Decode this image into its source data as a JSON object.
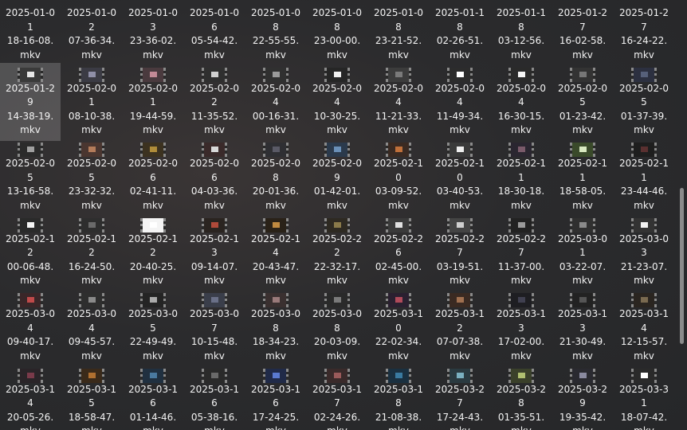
{
  "files": [
    {
      "name": "2025-01-01 18-16-08.mkv",
      "line1": "2025-01-0",
      "line2": "1",
      "line3": "18-16-08.",
      "ext": "mkv",
      "thumb_tone": "#2e2e2e"
    },
    {
      "name": "2025-01-02 07-36-34.mkv",
      "line1": "2025-01-0",
      "line2": "2",
      "line3": "07-36-34.",
      "ext": "mkv",
      "thumb_tone": "#2e2e2e"
    },
    {
      "name": "2025-01-03 23-36-02.mkv",
      "line1": "2025-01-0",
      "line2": "3",
      "line3": "23-36-02.",
      "ext": "mkv",
      "thumb_tone": "#2e2e2e"
    },
    {
      "name": "2025-01-06 05-54-42.mkv",
      "line1": "2025-01-0",
      "line2": "6",
      "line3": "05-54-42.",
      "ext": "mkv",
      "thumb_tone": "#2e2e2e"
    },
    {
      "name": "2025-01-08 22-55-55.mkv",
      "line1": "2025-01-0",
      "line2": "8",
      "line3": "22-55-55.",
      "ext": "mkv",
      "thumb_tone": "#2e2e2e"
    },
    {
      "name": "2025-01-08 23-00-00.mkv",
      "line1": "2025-01-0",
      "line2": "8",
      "line3": "23-00-00.",
      "ext": "mkv",
      "thumb_tone": "#2e2e2e"
    },
    {
      "name": "2025-01-08 23-21-52.mkv",
      "line1": "2025-01-0",
      "line2": "8",
      "line3": "23-21-52.",
      "ext": "mkv",
      "thumb_tone": "#2e2e2e"
    },
    {
      "name": "2025-01-18 02-26-51.mkv",
      "line1": "2025-01-1",
      "line2": "8",
      "line3": "02-26-51.",
      "ext": "mkv",
      "thumb_tone": "#2e2e2e"
    },
    {
      "name": "2025-01-18 03-12-56.mkv",
      "line1": "2025-01-1",
      "line2": "8",
      "line3": "03-12-56.",
      "ext": "mkv",
      "thumb_tone": "#2e2e2e"
    },
    {
      "name": "2025-01-27 16-02-58.mkv",
      "line1": "2025-01-2",
      "line2": "7",
      "line3": "16-02-58.",
      "ext": "mkv",
      "thumb_tone": "#2e2e2e"
    },
    {
      "name": "2025-01-27 16-24-22.mkv",
      "line1": "2025-01-2",
      "line2": "7",
      "line3": "16-24-22.",
      "ext": "mkv",
      "thumb_tone": "#2e2e2e"
    },
    {
      "name": "2025-01-29 14-38-19.mkv",
      "line1": "2025-01-2",
      "line2": "9",
      "line3": "14-38-19.",
      "ext": "mkv",
      "thumb_tone": "#3a3a3a",
      "spot": "#e8e8e8",
      "selected": true
    },
    {
      "name": "2025-02-01 08-10-38.mkv",
      "line1": "2025-02-0",
      "line2": "1",
      "line3": "08-10-38.",
      "ext": "mkv",
      "thumb_tone": "#3b3b44",
      "spot": "#8f8fa8"
    },
    {
      "name": "2025-02-01 19-44-59.mkv",
      "line1": "2025-02-0",
      "line2": "1",
      "line3": "19-44-59.",
      "ext": "mkv",
      "thumb_tone": "#4a3a3e",
      "spot": "#c48a96"
    },
    {
      "name": "2025-02-02 11-35-52.mkv",
      "line1": "2025-02-0",
      "line2": "2",
      "line3": "11-35-52.",
      "ext": "mkv",
      "thumb_tone": "#2f2f2f",
      "spot": "#d0d0d0"
    },
    {
      "name": "2025-02-04 00-16-31.mkv",
      "line1": "2025-02-0",
      "line2": "4",
      "line3": "00-16-31.",
      "ext": "mkv",
      "thumb_tone": "#303030",
      "spot": "#9a9a9a"
    },
    {
      "name": "2025-02-04 10-30-25.mkv",
      "line1": "2025-02-0",
      "line2": "4",
      "line3": "10-30-25.",
      "ext": "mkv",
      "thumb_tone": "#262626",
      "spot": "#f0f0f0"
    },
    {
      "name": "2025-02-04 11-21-33.mkv",
      "line1": "2025-02-0",
      "line2": "4",
      "line3": "11-21-33.",
      "ext": "mkv",
      "thumb_tone": "#3c3c3c",
      "spot": "#7a7a7a"
    },
    {
      "name": "2025-02-04 11-49-34.mkv",
      "line1": "2025-02-0",
      "line2": "4",
      "line3": "11-49-34.",
      "ext": "mkv",
      "thumb_tone": "#2c2c2c",
      "spot": "#ffffff"
    },
    {
      "name": "2025-02-04 16-30-15.mkv",
      "line1": "2025-02-0",
      "line2": "4",
      "line3": "16-30-15.",
      "ext": "mkv",
      "thumb_tone": "#2a2a2a",
      "spot": "#f5f5f5"
    },
    {
      "name": "2025-02-05 01-23-42.mkv",
      "line1": "2025-02-0",
      "line2": "5",
      "line3": "01-23-42.",
      "ext": "mkv",
      "thumb_tone": "#333",
      "spot": "#777"
    },
    {
      "name": "2025-02-05 01-37-39.mkv",
      "line1": "2025-02-0",
      "line2": "5",
      "line3": "01-37-39.",
      "ext": "mkv",
      "thumb_tone": "#2c3040",
      "spot": "#56607a"
    },
    {
      "name": "2025-02-05 13-16-58.mkv",
      "line1": "2025-02-0",
      "line2": "5",
      "line3": "13-16-58.",
      "ext": "mkv",
      "thumb_tone": "#2b2b2b",
      "spot": "#a0a0a0"
    },
    {
      "name": "2025-02-05 23-32-32.mkv",
      "line1": "2025-02-0",
      "line2": "5",
      "line3": "23-32-32.",
      "ext": "mkv",
      "thumb_tone": "#4a3630",
      "spot": "#b47c5a"
    },
    {
      "name": "2025-02-06 02-41-11.mkv",
      "line1": "2025-02-0",
      "line2": "6",
      "line3": "02-41-11.",
      "ext": "mkv",
      "thumb_tone": "#3c3220",
      "spot": "#b08d3a"
    },
    {
      "name": "2025-02-06 04-03-36.mkv",
      "line1": "2025-02-0",
      "line2": "6",
      "line3": "04-03-36.",
      "ext": "mkv",
      "thumb_tone": "#3a2a2a",
      "spot": "#d8d8d8"
    },
    {
      "name": "2025-02-08 20-01-36.mkv",
      "line1": "2025-02-0",
      "line2": "8",
      "line3": "20-01-36.",
      "ext": "mkv",
      "thumb_tone": "#2f2f33",
      "spot": "#5a5a66"
    },
    {
      "name": "2025-02-09 01-42-01.mkv",
      "line1": "2025-02-0",
      "line2": "9",
      "line3": "01-42-01.",
      "ext": "mkv",
      "thumb_tone": "#2b3a4c",
      "spot": "#6a90b8"
    },
    {
      "name": "2025-02-10 03-09-52.mkv",
      "line1": "2025-02-1",
      "line2": "0",
      "line3": "03-09-52.",
      "ext": "mkv",
      "thumb_tone": "#3a2a22",
      "spot": "#c0703a"
    },
    {
      "name": "2025-02-10 03-40-53.mkv",
      "line1": "2025-02-1",
      "line2": "0",
      "line3": "03-40-53.",
      "ext": "mkv",
      "thumb_tone": "#3a3a3a",
      "spot": "#eeeeee"
    },
    {
      "name": "2025-02-11 18-30-18.mkv",
      "line1": "2025-02-1",
      "line2": "1",
      "line3": "18-30-18.",
      "ext": "mkv",
      "thumb_tone": "#2a2630",
      "spot": "#7a5a6a"
    },
    {
      "name": "2025-02-11 18-58-05.mkv",
      "line1": "2025-02-1",
      "line2": "1",
      "line3": "18-58-05.",
      "ext": "mkv",
      "thumb_tone": "#3a4a2a",
      "spot": "#d8e8c0"
    },
    {
      "name": "2025-02-11 23-44-46.mkv",
      "line1": "2025-02-1",
      "line2": "1",
      "line3": "23-44-46.",
      "ext": "mkv",
      "thumb_tone": "#1e1e1e",
      "spot": "#5a3030"
    },
    {
      "name": "2025-02-12 00-06-48.mkv",
      "line1": "2025-02-1",
      "line2": "2",
      "line3": "00-06-48.",
      "ext": "mkv",
      "thumb_tone": "#2a2a2a",
      "spot": "#f4f4f4"
    },
    {
      "name": "2025-02-12 16-24-50.mkv",
      "line1": "2025-02-1",
      "line2": "2",
      "line3": "16-24-50.",
      "ext": "mkv",
      "thumb_tone": "#2e2e2e",
      "spot": "#6a6a6a"
    },
    {
      "name": "2025-02-12 20-40-25.mkv",
      "line1": "2025-02-1",
      "line2": "2",
      "line3": "20-40-25.",
      "ext": "mkv",
      "thumb_tone": "#f4f4f4",
      "spot": "#ffffff"
    },
    {
      "name": "2025-02-13 09-14-07.mkv",
      "line1": "2025-02-1",
      "line2": "3",
      "line3": "09-14-07.",
      "ext": "mkv",
      "thumb_tone": "#2a2420",
      "spot": "#b04a3a"
    },
    {
      "name": "2025-02-14 20-43-47.mkv",
      "line1": "2025-02-1",
      "line2": "4",
      "line3": "20-43-47.",
      "ext": "mkv",
      "thumb_tone": "#2a2218",
      "spot": "#c08a40"
    },
    {
      "name": "2025-02-22 22-32-17.mkv",
      "line1": "2025-02-2",
      "line2": "2",
      "line3": "22-32-17.",
      "ext": "mkv",
      "thumb_tone": "#2e2a22",
      "spot": "#8a7a4a"
    },
    {
      "name": "2025-02-26 02-45-00.mkv",
      "line1": "2025-02-2",
      "line2": "6",
      "line3": "02-45-00.",
      "ext": "mkv",
      "thumb_tone": "#3a3a3a",
      "spot": "#e0e0e0"
    },
    {
      "name": "2025-02-27 03-19-51.mkv",
      "line1": "2025-02-2",
      "line2": "7",
      "line3": "03-19-51.",
      "ext": "mkv",
      "thumb_tone": "#444",
      "spot": "#cfcfcf"
    },
    {
      "name": "2025-02-27 11-37-00.mkv",
      "line1": "2025-02-2",
      "line2": "7",
      "line3": "11-37-00.",
      "ext": "mkv",
      "thumb_tone": "#222",
      "spot": "#9a9a9a"
    },
    {
      "name": "2025-03-01 03-22-07.mkv",
      "line1": "2025-03-0",
      "line2": "1",
      "line3": "03-22-07.",
      "ext": "mkv",
      "thumb_tone": "#303030",
      "spot": "#8a8a8a"
    },
    {
      "name": "2025-03-03 21-23-07.mkv",
      "line1": "2025-03-0",
      "line2": "3",
      "line3": "21-23-07.",
      "ext": "mkv",
      "thumb_tone": "#333",
      "spot": "#f2f2f2"
    },
    {
      "name": "2025-03-04 09-40-17.mkv",
      "line1": "2025-03-0",
      "line2": "4",
      "line3": "09-40-17.",
      "ext": "mkv",
      "thumb_tone": "#3a2628",
      "spot": "#c04a4a"
    },
    {
      "name": "2025-03-04 09-45-57.mkv",
      "line1": "2025-03-0",
      "line2": "4",
      "line3": "09-45-57.",
      "ext": "mkv",
      "thumb_tone": "#2e2e2e",
      "spot": "#8a8a8a"
    },
    {
      "name": "2025-03-05 22-49-49.mkv",
      "line1": "2025-03-0",
      "line2": "5",
      "line3": "22-49-49.",
      "ext": "mkv",
      "thumb_tone": "#242424",
      "spot": "#aaaaaa"
    },
    {
      "name": "2025-03-07 10-15-48.mkv",
      "line1": "2025-03-0",
      "line2": "7",
      "line3": "10-15-48.",
      "ext": "mkv",
      "thumb_tone": "#3a3e4a",
      "spot": "#6a7088"
    },
    {
      "name": "2025-03-08 18-34-23.mkv",
      "line1": "2025-03-0",
      "line2": "8",
      "line3": "18-34-23.",
      "ext": "mkv",
      "thumb_tone": "#3a3030",
      "spot": "#9a7a7a"
    },
    {
      "name": "2025-03-08 20-03-09.mkv",
      "line1": "2025-03-0",
      "line2": "8",
      "line3": "20-03-09.",
      "ext": "mkv",
      "thumb_tone": "#2a2a2a",
      "spot": "#7a7a7a"
    },
    {
      "name": "2025-03-10 22-02-34.mkv",
      "line1": "2025-03-1",
      "line2": "0",
      "line3": "22-02-34.",
      "ext": "mkv",
      "thumb_tone": "#2a2030",
      "spot": "#b04a5a"
    },
    {
      "name": "2025-03-12 07-07-38.mkv",
      "line1": "2025-03-1",
      "line2": "2",
      "line3": "07-07-38.",
      "ext": "mkv",
      "thumb_tone": "#3a2a22",
      "spot": "#a07050"
    },
    {
      "name": "2025-03-13 17-02-00.mkv",
      "line1": "2025-03-1",
      "line2": "3",
      "line3": "17-02-00.",
      "ext": "mkv",
      "thumb_tone": "#1e1e22",
      "spot": "#404050"
    },
    {
      "name": "2025-03-13 21-30-49.mkv",
      "line1": "2025-03-1",
      "line2": "3",
      "line3": "21-30-49.",
      "ext": "mkv",
      "thumb_tone": "#222",
      "spot": "#555"
    },
    {
      "name": "2025-03-14 12-15-57.mkv",
      "line1": "2025-03-1",
      "line2": "4",
      "line3": "12-15-57.",
      "ext": "mkv",
      "thumb_tone": "#2a2520",
      "spot": "#7a6a50"
    },
    {
      "name": "2025-03-14 20-05-26.mkv",
      "line1": "2025-03-1",
      "line2": "4",
      "line3": "20-05-26.",
      "ext": "mkv",
      "thumb_tone": "#2a2428",
      "spot": "#7a3a4a"
    },
    {
      "name": "2025-03-15 18-58-47.mkv",
      "line1": "2025-03-1",
      "line2": "5",
      "line3": "18-58-47.",
      "ext": "mkv",
      "thumb_tone": "#3a2a1a",
      "spot": "#b07030"
    },
    {
      "name": "2025-03-16 01-14-46.mkv",
      "line1": "2025-03-1",
      "line2": "6",
      "line3": "01-14-46.",
      "ext": "mkv",
      "thumb_tone": "#203040",
      "spot": "#4a7aa0"
    },
    {
      "name": "2025-03-16 05-38-16.mkv",
      "line1": "2025-03-1",
      "line2": "6",
      "line3": "05-38-16.",
      "ext": "mkv",
      "thumb_tone": "#2a2a2a",
      "spot": "#6a6a6a"
    },
    {
      "name": "2025-03-16 17-24-25.mkv",
      "line1": "2025-03-1",
      "line2": "6",
      "line3": "17-24-25.",
      "ext": "mkv",
      "thumb_tone": "#202a48",
      "spot": "#5a7ad0"
    },
    {
      "name": "2025-03-17 02-24-26.mkv",
      "line1": "2025-03-1",
      "line2": "7",
      "line3": "02-24-26.",
      "ext": "mkv",
      "thumb_tone": "#3a2a2a",
      "spot": "#9a5a5a"
    },
    {
      "name": "2025-03-18 21-08-38.mkv",
      "line1": "2025-03-1",
      "line2": "8",
      "line3": "21-08-38.",
      "ext": "mkv",
      "thumb_tone": "#1a3040",
      "spot": "#3a7aa0"
    },
    {
      "name": "2025-03-27 17-24-43.mkv",
      "line1": "2025-03-2",
      "line2": "7",
      "line3": "17-24-43.",
      "ext": "mkv",
      "thumb_tone": "#2a3a40",
      "spot": "#7ab0c0"
    },
    {
      "name": "2025-03-28 01-35-51.mkv",
      "line1": "2025-03-2",
      "line2": "8",
      "line3": "01-35-51.",
      "ext": "mkv",
      "thumb_tone": "#3a402a",
      "spot": "#b0c070"
    },
    {
      "name": "2025-03-29 19-35-42.mkv",
      "line1": "2025-03-2",
      "line2": "9",
      "line3": "19-35-42.",
      "ext": "mkv",
      "thumb_tone": "#2a2a30",
      "spot": "#8a8aa0"
    },
    {
      "name": "2025-03-31 18-07-42.mkv",
      "line1": "2025-03-3",
      "line2": "1",
      "line3": "18-07-42.",
      "ext": "mkv",
      "thumb_tone": "#2a2a2a",
      "spot": "#ffffff"
    }
  ],
  "icon_name": "video-file-icon"
}
